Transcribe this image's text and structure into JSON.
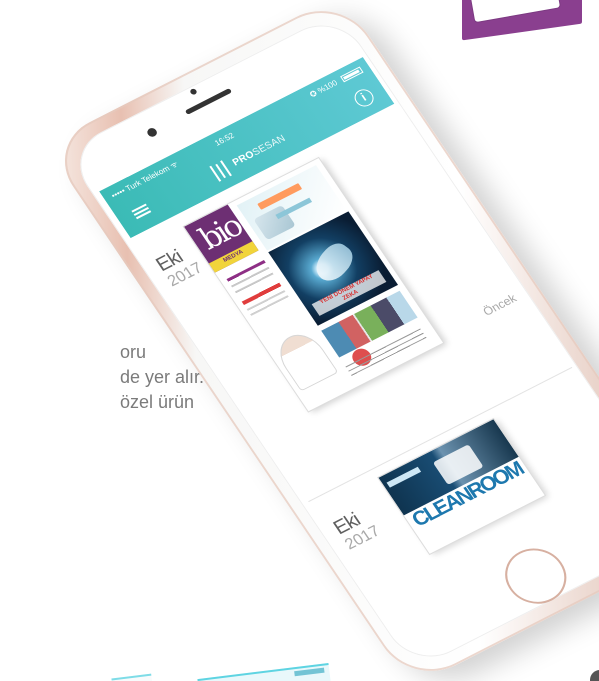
{
  "background_snippets": {
    "left_copy": [
      "oru",
      "de yer alır.",
      "özel ürün"
    ],
    "bottom_thumbnail_label": ""
  },
  "app": {
    "status": {
      "carrier": "••••• Turk Telekom ᯤ",
      "time": "16:52",
      "right": "✪ %100"
    },
    "brand": {
      "name_bold": "PRO",
      "name_light": "SESAN",
      "subtitle": ""
    },
    "info_icon": "i"
  },
  "issues": [
    {
      "month": "Eki",
      "year": "2017",
      "action": "Öncek",
      "cover": {
        "brand": "bio",
        "brand_sub": "MEDYA",
        "headline": "YENİ DÖNEM YAPAY ZEKA"
      }
    },
    {
      "month": "Eki",
      "year": "2017",
      "cover": {
        "title": "CLEANROOM"
      }
    }
  ],
  "colors": {
    "appbar_start": "#3bbbb6",
    "appbar_end": "#5ec9d4",
    "bio_purple": "#6d2f73",
    "cleanroom_blue": "#1d78ae",
    "phone_rose": "#e3b7a8"
  }
}
